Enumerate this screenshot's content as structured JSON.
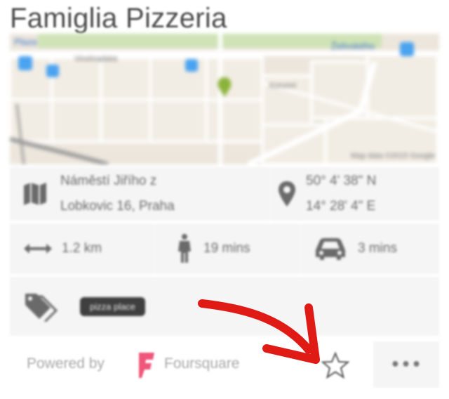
{
  "venue": {
    "title": "Famiglia Pizzeria"
  },
  "map": {
    "labels": {
      "top_left": "Plaza",
      "street_1": "Vinohradská",
      "street_2": "Korunní",
      "top_right": "Želivského"
    },
    "credit": "Map data ©2015 Google",
    "pin_color": "#8bb33b",
    "accent_blue": "#4aa3f0"
  },
  "info": {
    "address_line1": "Náměstí Jiřího z",
    "address_line2": "Lobkovic 16, Praha",
    "lat": "50° 4' 38\" N",
    "lon": "14° 28' 4\" E",
    "distance": "1.2 km",
    "walk_time": "19 mins",
    "drive_time": "3 mins",
    "tag": "pizza place"
  },
  "footer": {
    "powered_by": "Powered by",
    "provider": "Foursquare",
    "more_label": "•••"
  },
  "colors": {
    "annotation_arrow": "#e01a14",
    "foursquare": "#f0557a"
  }
}
